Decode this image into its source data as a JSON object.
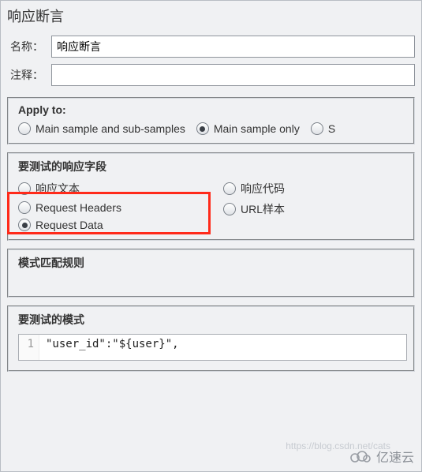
{
  "title": "响应断言",
  "fields": {
    "name_label": "名称：",
    "name_value": "响应断言",
    "comment_label": "注释：",
    "comment_value": ""
  },
  "apply_to": {
    "label": "Apply to:",
    "options": [
      {
        "label": "Main sample and sub-samples",
        "checked": false
      },
      {
        "label": "Main sample only",
        "checked": true
      },
      {
        "label": "S",
        "checked": false
      }
    ]
  },
  "response_field": {
    "label": "要测试的响应字段",
    "left": [
      {
        "label": "响应文本",
        "checked": false
      },
      {
        "label": "Request Headers",
        "checked": false
      },
      {
        "label": "Request Data",
        "checked": true
      }
    ],
    "right": [
      {
        "label": "响应代码",
        "checked": false
      },
      {
        "label": "URL样本",
        "checked": false
      }
    ]
  },
  "match_rules": {
    "label": "模式匹配规则"
  },
  "test_pattern": {
    "label": "要测试的模式",
    "line_number": "1",
    "code": "\"user_id\":\"${user}\","
  },
  "watermark": {
    "text": "亿速云",
    "faint": "https://blog.csdn.net/cats"
  }
}
